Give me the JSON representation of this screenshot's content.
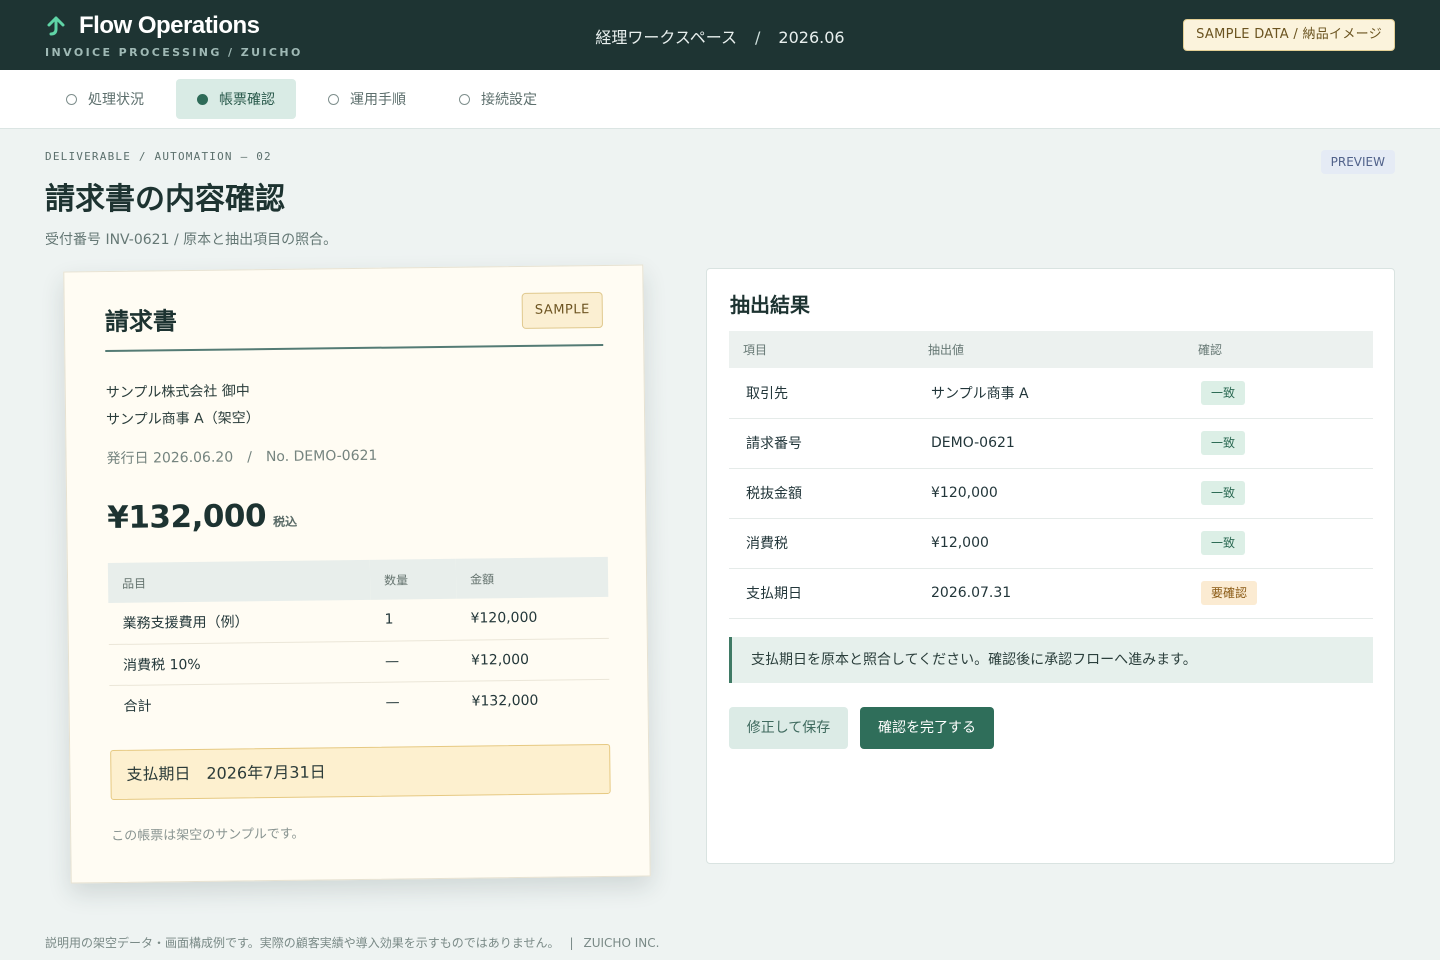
{
  "header": {
    "brand_name": "Flow Operations",
    "brand_sub": "INVOICE PROCESSING / ZUICHO",
    "workspace": "経理ワークスペース",
    "period_separator": "/",
    "period": "2026.06",
    "sample_badge": "SAMPLE DATA / 納品イメージ",
    "brand_icon": "arrow-up-icon"
  },
  "tabs": [
    {
      "label": "処理状況",
      "active": false
    },
    {
      "label": "帳票確認",
      "active": true
    },
    {
      "label": "運用手順",
      "active": false
    },
    {
      "label": "接続設定",
      "active": false
    }
  ],
  "page": {
    "eyebrow": "DELIVERABLE / AUTOMATION — 02",
    "preview_badge": "PREVIEW",
    "title": "請求書の内容確認",
    "subtitle": "受付番号 INV-0621 / 原本と抽出項目の照合。"
  },
  "invoice": {
    "title": "請求書",
    "sample_label": "SAMPLE",
    "addressee": "サンプル株式会社 御中",
    "issuer": "サンプル商事 A（架空）",
    "issue_date": "発行日 2026.06.20",
    "meta_separator": "/",
    "number": "No. DEMO-0621",
    "total": "¥132,000",
    "tax_label": "税込",
    "columns": [
      "品目",
      "数量",
      "金額"
    ],
    "rows": [
      [
        "業務支援費用（例）",
        "1",
        "¥120,000"
      ],
      [
        "消費税 10%",
        "—",
        "¥12,000"
      ],
      [
        "合計",
        "—",
        "¥132,000"
      ]
    ],
    "due_label": "支払期日",
    "due_value": "2026年7月31日",
    "note": "この帳票は架空のサンプルです。"
  },
  "result": {
    "title": "抽出結果",
    "columns": [
      "項目",
      "抽出値",
      "確認"
    ],
    "rows": [
      {
        "field": "取引先",
        "value": "サンプル商事 A",
        "status": "一致",
        "status_type": "ok"
      },
      {
        "field": "請求番号",
        "value": "DEMO-0621",
        "status": "一致",
        "status_type": "ok"
      },
      {
        "field": "税抜金額",
        "value": "¥120,000",
        "status": "一致",
        "status_type": "ok"
      },
      {
        "field": "消費税",
        "value": "¥12,000",
        "status": "一致",
        "status_type": "ok"
      },
      {
        "field": "支払期日",
        "value": "2026.07.31",
        "status": "要確認",
        "status_type": "warn"
      }
    ],
    "notice": "支払期日を原本と照合してください。確認後に承認フローへ進みます。",
    "secondary_button": "修正して保存",
    "primary_button": "確認を完了する"
  },
  "footer": {
    "disclaimer": "説明用の架空データ・画面構成例です。実際の顧客実績や導入効果を示すものではありません。",
    "separator": "|",
    "company": "ZUICHO INC."
  },
  "colors": {
    "header_bg": "#1e3433",
    "accent": "#2f6e5a",
    "brand_icon": "#5fd4a6",
    "ok_badge_bg": "#dcefe6",
    "warn_badge_bg": "#fbebd2",
    "page_bg": "#eef3f2"
  }
}
